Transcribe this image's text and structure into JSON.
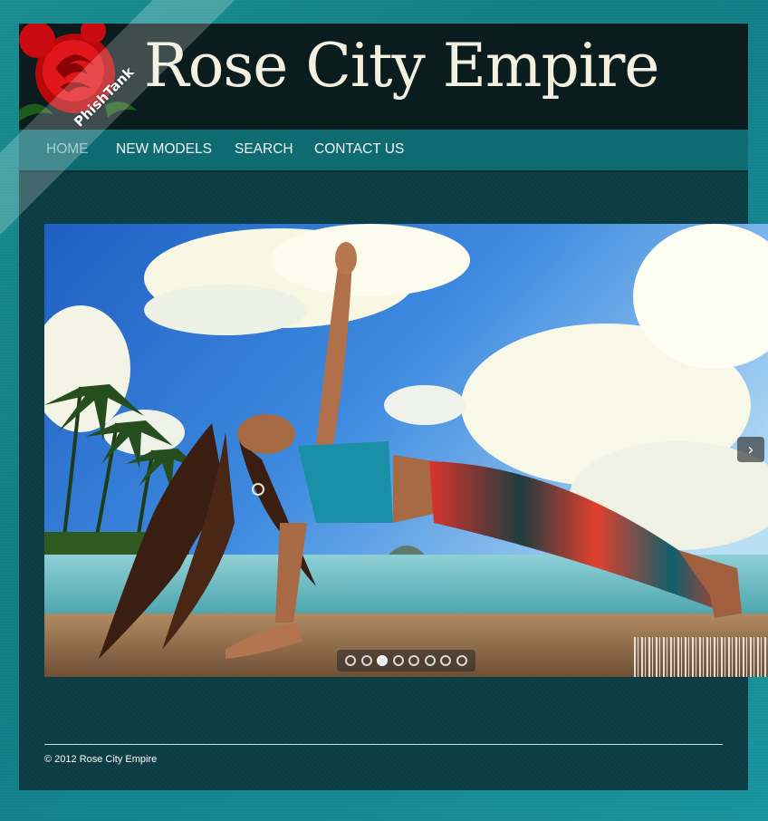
{
  "header": {
    "site_title": "Rose City Empire"
  },
  "nav": {
    "items": [
      {
        "label": "HOME",
        "active": true
      },
      {
        "label": "NEW MODELS",
        "active": false
      },
      {
        "label": "SEARCH",
        "active": false
      },
      {
        "label": "CONTACT US",
        "active": false
      }
    ]
  },
  "watermark": {
    "ribbon_text": "PhishTank"
  },
  "slider": {
    "next_icon": "chevron-right-icon",
    "next_glyph": "›",
    "slide_count": 8,
    "active_slide": 3
  },
  "footer": {
    "copyright": "© 2012 Rose City Empire"
  },
  "colors": {
    "background": "#1a8f93",
    "container": "#0b3c44",
    "header": "#0a1c1e",
    "navbar": "#0f6b72",
    "title_text": "#f3f0df"
  }
}
